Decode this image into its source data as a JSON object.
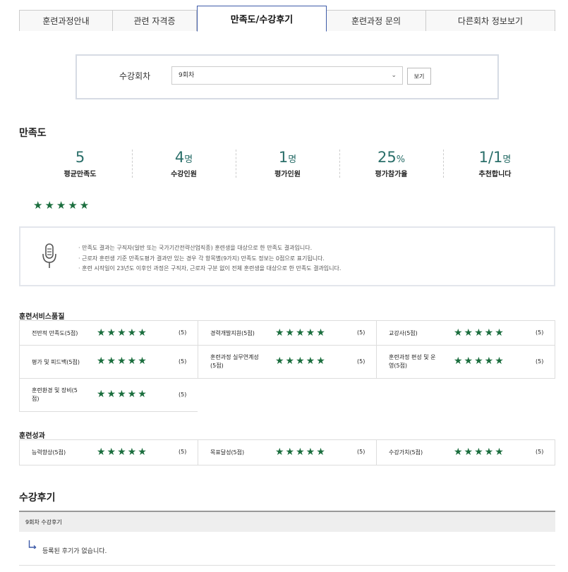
{
  "tabs": [
    {
      "label": "훈련과정안내"
    },
    {
      "label": "관련 자격증"
    },
    {
      "label": "만족도/수강후기"
    },
    {
      "label": "훈련과정 문의"
    },
    {
      "label": "다른회차 정보보기"
    }
  ],
  "session": {
    "label": "수강회차",
    "selected": "9회차",
    "view_button": "보기"
  },
  "satisfaction": {
    "title": "만족도",
    "stats": [
      {
        "value": "5",
        "unit": "",
        "label": "평균만족도"
      },
      {
        "value": "4",
        "unit": "명",
        "label": "수강인원"
      },
      {
        "value": "1",
        "unit": "명",
        "label": "평가인원"
      },
      {
        "value": "25",
        "unit": "%",
        "label": "평가참가율"
      },
      {
        "value": "1/1",
        "unit": "명",
        "label": "추천합니다"
      }
    ],
    "average_stars": "★★★★★",
    "notice": [
      "· 만족도 결과는 구직자(일반 또는 국가기간전략산업직종) 훈련생을 대상으로 한 만족도 결과입니다.",
      "· 근로자 훈련생 기준 만족도평가 결과만 있는 경우 각 항목별(9가지) 만족도 정보는 0점으로 표기됩니다.",
      "· 훈련 시작일이 23년도 이후인 과정은 구직자, 근로자 구분 없이 전체 훈련생을 대상으로 한 만족도 결과입니다."
    ]
  },
  "service_quality": {
    "title": "훈련서비스품질",
    "items": [
      {
        "name": "전반적 만족도(5점)",
        "stars": "★★★★★",
        "score": "(5)"
      },
      {
        "name": "경력개발지원(5점)",
        "stars": "★★★★★",
        "score": "(5)"
      },
      {
        "name": "교강사(5점)",
        "stars": "★★★★★",
        "score": "(5)"
      },
      {
        "name": "평가 및 피드백(5점)",
        "stars": "★★★★★",
        "score": "(5)"
      },
      {
        "name": "훈련과정 실무연계성(5점)",
        "stars": "★★★★★",
        "score": "(5)"
      },
      {
        "name": "훈련과정 편성 및 운영(5점)",
        "stars": "★★★★★",
        "score": "(5)"
      },
      {
        "name": "훈련환경 및 장비(5점)",
        "stars": "★★★★★",
        "score": "(5)"
      }
    ]
  },
  "outcome": {
    "title": "훈련성과",
    "items": [
      {
        "name": "능력향상(5점)",
        "stars": "★★★★★",
        "score": "(5)"
      },
      {
        "name": "목표달성(5점)",
        "stars": "★★★★★",
        "score": "(5)"
      },
      {
        "name": "수강가치(5점)",
        "stars": "★★★★★",
        "score": "(5)"
      }
    ]
  },
  "reviews": {
    "title": "수강후기",
    "header": "9회차 수강후기",
    "empty": "등록된 후기가 없습니다."
  },
  "colors": {
    "accent": "#3d5aa8",
    "stat": "#2b6f6a",
    "star": "#1b6e3e"
  }
}
